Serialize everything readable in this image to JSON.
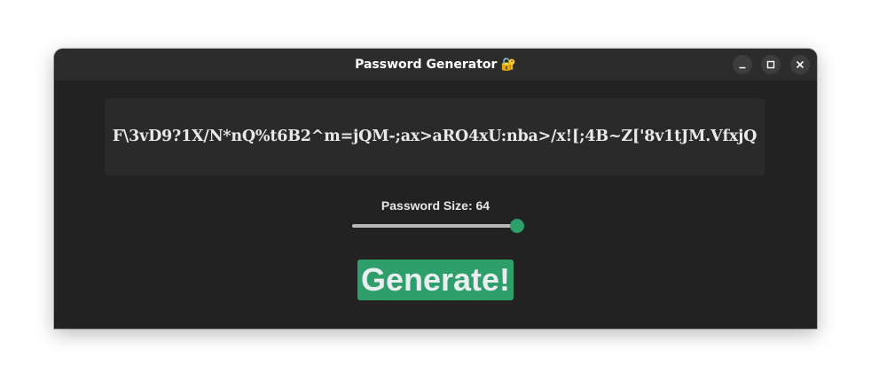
{
  "window": {
    "title": "Password Generator",
    "title_icon": "🔐",
    "controls": [
      "minimize-icon",
      "maximize-icon",
      "close-icon"
    ]
  },
  "password": {
    "value": "F\\3vD9?1X/N*nQ%t6B2^m=jQM-;ax>aRO4xU:nba>/x![;4B~Z['8v1tJM.VfxjQ"
  },
  "size": {
    "label": "Password Size: 64",
    "value": 64,
    "fraction": 1.0
  },
  "generate": {
    "label": "Generate!"
  },
  "colors": {
    "accent": "#2e9e6a",
    "background": "#222222",
    "panel": "#2a2a2a",
    "titlebar": "#2c2c2c"
  }
}
